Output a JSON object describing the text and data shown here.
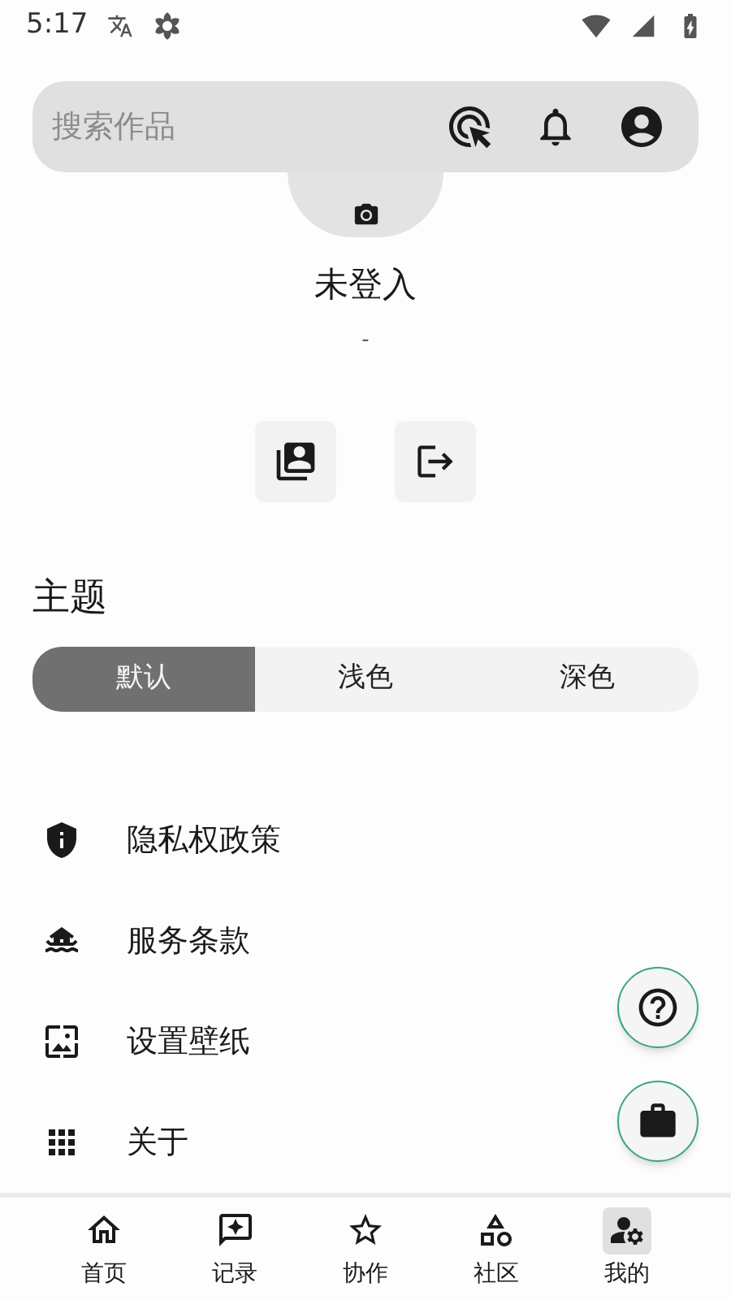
{
  "status_bar": {
    "time": "5:17"
  },
  "search": {
    "placeholder": "搜索作品"
  },
  "profile": {
    "name": "未登入",
    "subtitle": "-"
  },
  "theme": {
    "title": "主题",
    "options": [
      {
        "label": "默认",
        "selected": true
      },
      {
        "label": "浅色",
        "selected": false
      },
      {
        "label": "深色",
        "selected": false
      }
    ]
  },
  "menu": [
    {
      "label": "隐私权政策"
    },
    {
      "label": "服务条款"
    },
    {
      "label": "设置壁纸"
    },
    {
      "label": "关于"
    }
  ],
  "bottom_nav": [
    {
      "label": "首页",
      "selected": false
    },
    {
      "label": "记录",
      "selected": false
    },
    {
      "label": "协作",
      "selected": false
    },
    {
      "label": "社区",
      "selected": false
    },
    {
      "label": "我的",
      "selected": true
    }
  ]
}
